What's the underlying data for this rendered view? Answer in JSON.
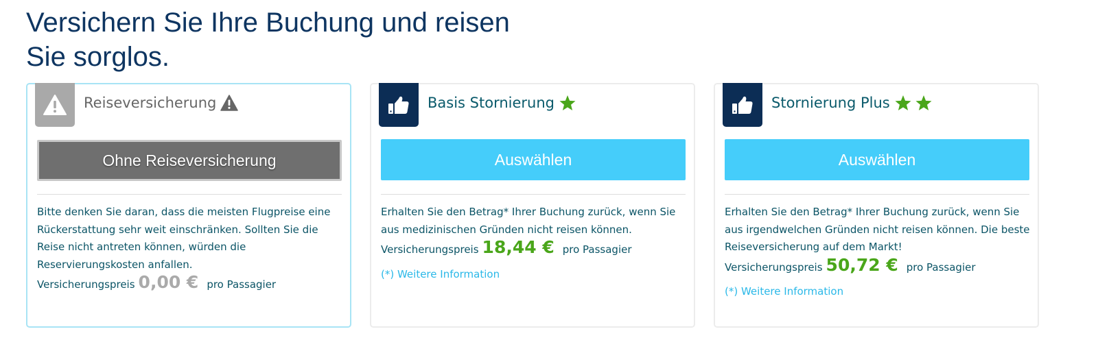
{
  "header": {
    "title": "Versichern Sie Ihre Buchung und reisen Sie sorglos."
  },
  "colors": {
    "title": "#0e3561",
    "navy_tab": "#0c2d55",
    "gray_tab": "#a9a9a9",
    "button_blue": "#45cdfa",
    "button_gray": "#6f6f6f",
    "price_green": "#4aa61a",
    "text_teal": "#0b5466",
    "link_blue": "#2ab8e8",
    "star_green": "#4aa61a"
  },
  "cards": [
    {
      "tab_icon": "warning-icon",
      "title": "Reiseversicherung",
      "title_icon": "warning-icon",
      "stars": 0,
      "button_label": "Ohne Reiseversicherung",
      "description": "Bitte denken Sie daran, dass die meisten Flugpreise eine Rückerstattung sehr weit einschränken. Sollten Sie die Reise nicht antreten können, würden die Reservierungskosten anfallen.",
      "price_label": "Versicherungspreis",
      "price": "0,00 €",
      "per_label": "pro Passagier",
      "selected": true
    },
    {
      "tab_icon": "thumbs-up-icon",
      "title": "Basis Stornierung",
      "stars": 1,
      "button_label": "Auswählen",
      "description": "Erhalten Sie den Betrag* Ihrer Buchung zurück, wenn Sie aus medizinischen Gründen nicht reisen können.",
      "price_label": "Versicherungspreis",
      "price": "18,44 €",
      "per_label": "pro Passagier",
      "link": "(*) Weitere Information"
    },
    {
      "tab_icon": "thumbs-up-icon",
      "title": "Stornierung Plus",
      "stars": 2,
      "button_label": "Auswählen",
      "description": "Erhalten Sie den Betrag* Ihrer Buchung zurück, wenn Sie aus irgendwelchen Gründen nicht reisen können. Die beste Reiseversicherung auf dem Markt!",
      "price_label": "Versicherungspreis",
      "price": "50,72 €",
      "per_label": "pro Passagier",
      "link": "(*) Weitere Information"
    }
  ]
}
